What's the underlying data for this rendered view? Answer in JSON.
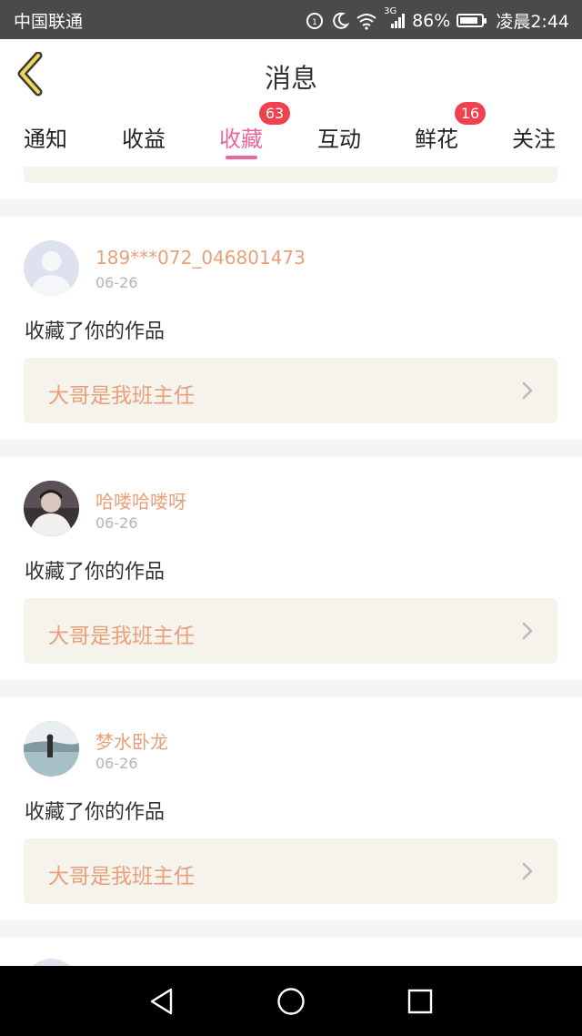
{
  "status_bar": {
    "carrier": "中国联通",
    "network": "3G",
    "battery": "86%",
    "battery_level": 0.86,
    "time": "凌晨2:44"
  },
  "header": {
    "title": "消息"
  },
  "tabs": [
    {
      "label": "通知"
    },
    {
      "label": "收益"
    },
    {
      "label": "收藏",
      "badge": "63",
      "active": true
    },
    {
      "label": "互动"
    },
    {
      "label": "鲜花",
      "badge": "16"
    },
    {
      "label": "关注"
    }
  ],
  "notifications": [
    {
      "user": "189***072_046801473",
      "date": "06-26",
      "action": "收藏了你的作品",
      "work_title": "大哥是我班主任"
    },
    {
      "user": "哈喽哈喽呀",
      "date": "06-26",
      "action": "收藏了你的作品",
      "work_title": "大哥是我班主任"
    },
    {
      "user": "梦水卧龙",
      "date": "06-26",
      "action": "收藏了你的作品",
      "work_title": "大哥是我班主任"
    }
  ],
  "colors": {
    "accent": "#e8689d",
    "badge": "#f0414e",
    "username": "#e8a07a",
    "work_bg": "#f5f3ec"
  }
}
